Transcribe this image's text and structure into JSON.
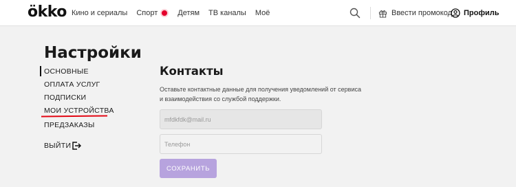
{
  "header": {
    "logo": "ökko",
    "nav": [
      {
        "id": "movies",
        "label": "Кино и сериалы"
      },
      {
        "id": "sport",
        "label": "Спорт",
        "live": true
      },
      {
        "id": "kids",
        "label": "Детям"
      },
      {
        "id": "tv",
        "label": "ТВ каналы"
      },
      {
        "id": "my",
        "label": "Моё"
      }
    ],
    "search_icon": "search-icon",
    "promo_label": "Ввести промокод",
    "promo_icon": "gift-icon",
    "profile_label": "Профиль",
    "profile_icon": "user-icon",
    "live_color": "#e4002b"
  },
  "sidebar": {
    "title": "Настройки",
    "items": [
      {
        "label": "ОСНОВНЫЕ",
        "active": true
      },
      {
        "label": "ОПЛАТА УСЛУГ"
      },
      {
        "label": "ПОДПИСКИ"
      },
      {
        "label": "МОИ УСТРОЙСТВА",
        "highlighted": true
      },
      {
        "label": "ПРЕДЗАКАЗЫ"
      }
    ],
    "logout_label": "ВЫЙТИ",
    "logout_icon": "logout-icon",
    "highlight_color": "#e30613"
  },
  "main": {
    "title": "Контакты",
    "description": "Оставьте контактные данные для получения уведомлений от сервиса и взаимодействия со службой поддержки.",
    "email_value": "mfdkfdk@mail.ru",
    "phone_placeholder": "Телефон",
    "save_label": "СОХРАНИТЬ",
    "button_color": "#b7a3de"
  }
}
